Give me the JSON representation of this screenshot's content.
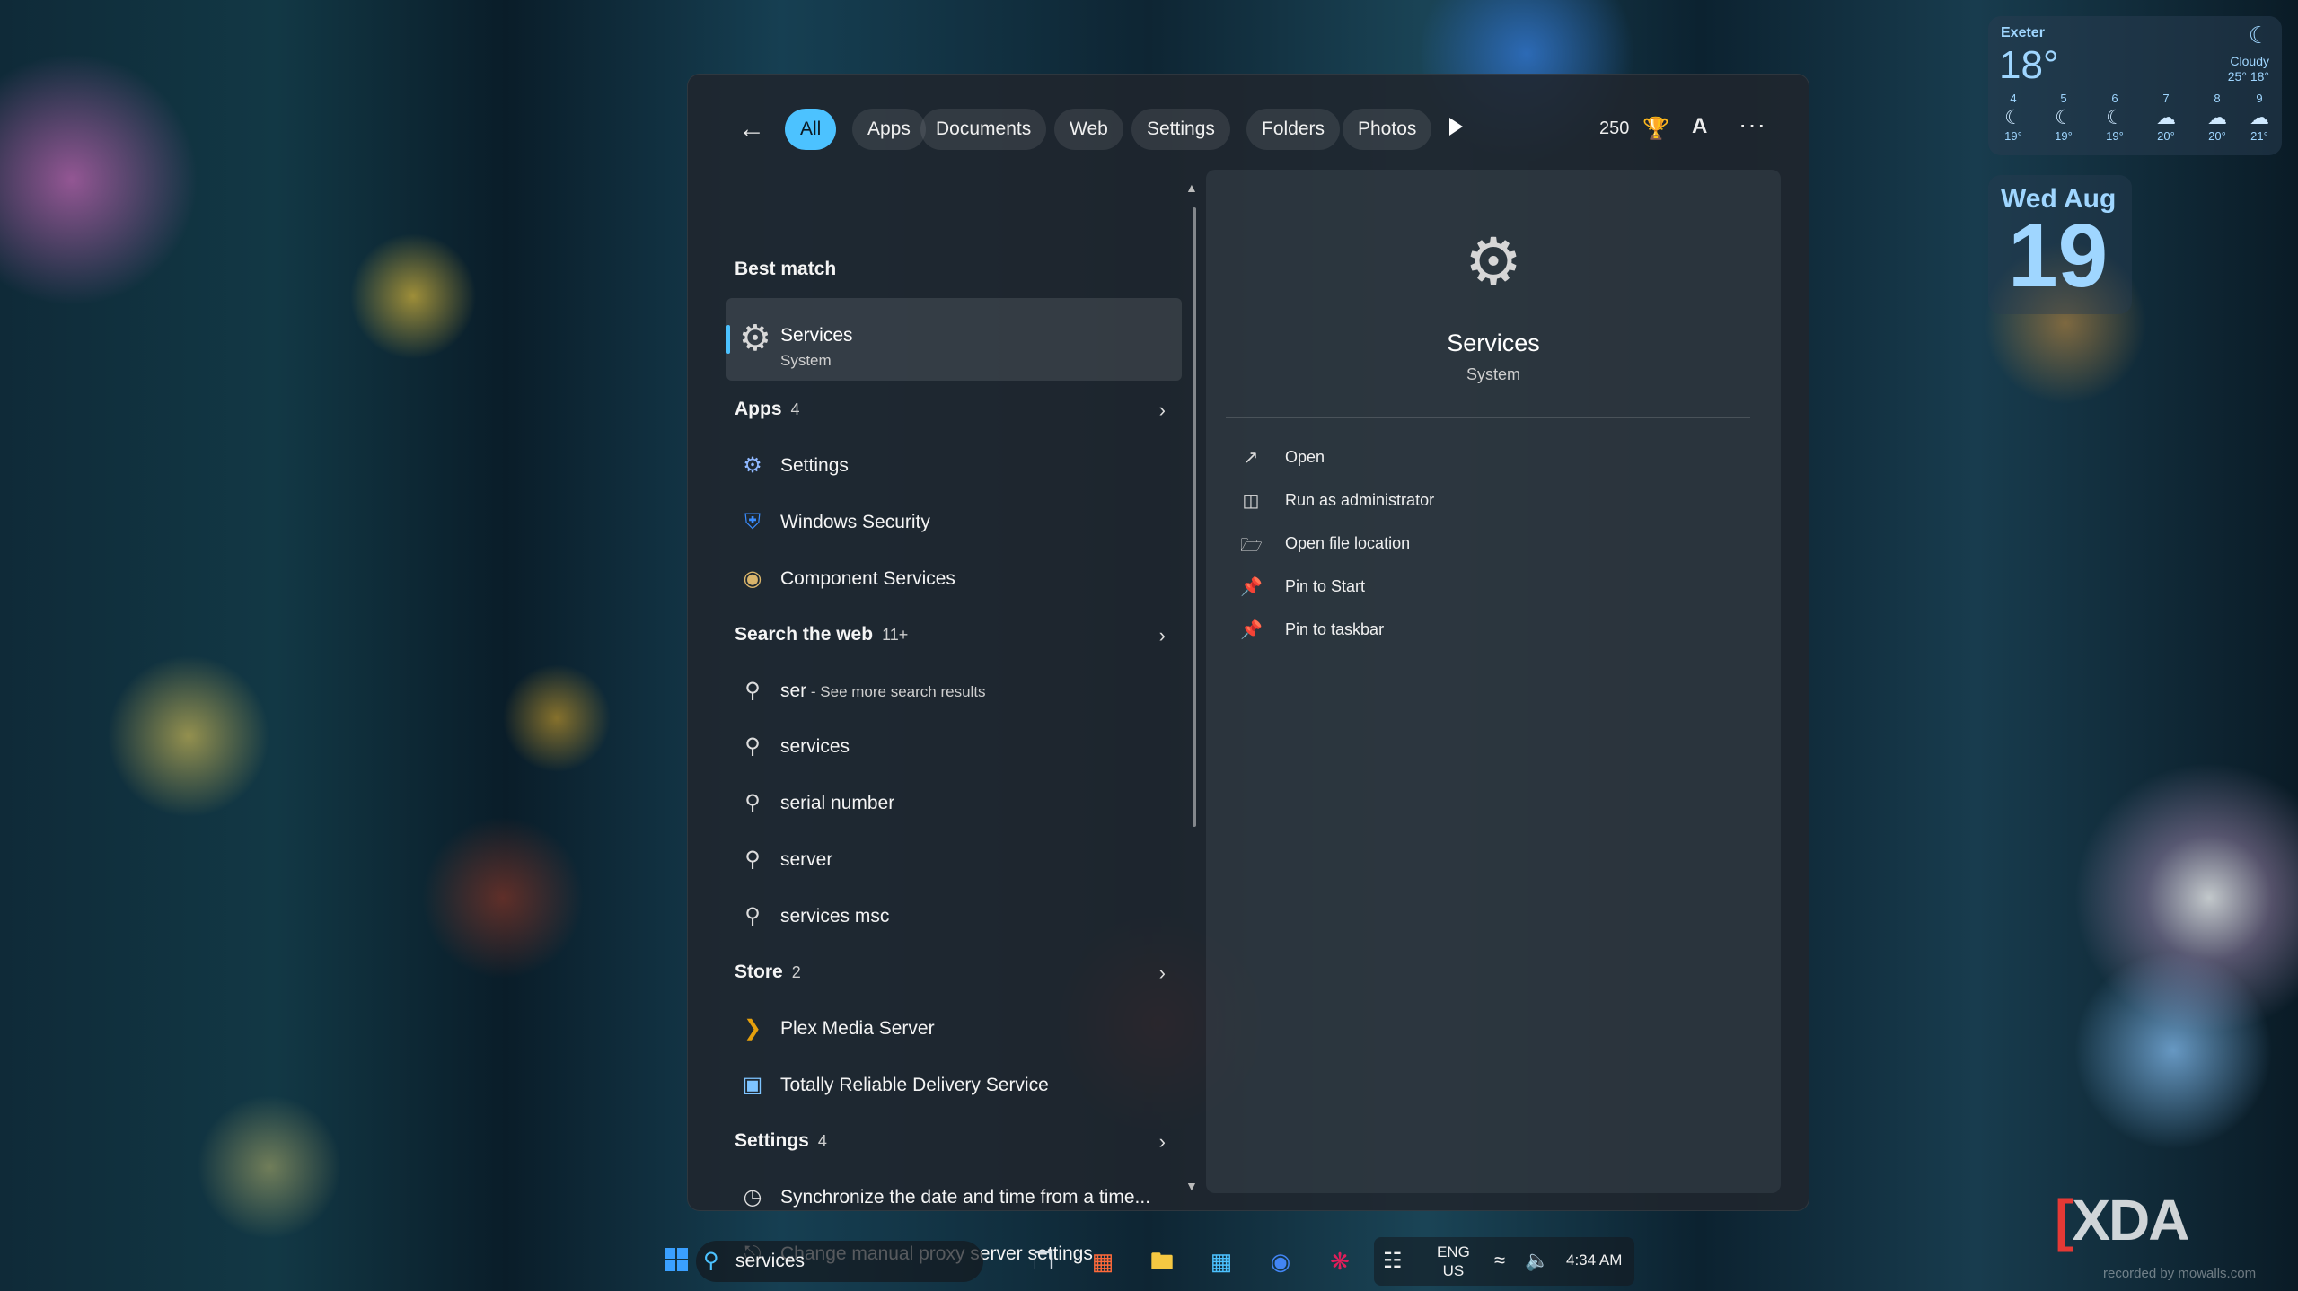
{
  "filters": {
    "tabs": [
      "All",
      "Apps",
      "Documents",
      "Web",
      "Settings",
      "Folders",
      "Photos"
    ],
    "active": "All",
    "points": "250",
    "avatar_letter": "A"
  },
  "results": {
    "best_match_header": "Best match",
    "best_match": {
      "title": "Services",
      "subtitle": "System"
    },
    "apps_header": "Apps",
    "apps_count": "4",
    "apps": [
      "Settings",
      "Windows Security",
      "Component Services"
    ],
    "web_header": "Search the web",
    "web_count": "11+",
    "web_first_query": "ser",
    "web_first_hint": " - See more search results",
    "web": [
      "services",
      "serial number",
      "server",
      "services msc"
    ],
    "store_header": "Store",
    "store_count": "2",
    "store": [
      "Plex Media Server",
      "Totally Reliable Delivery Service"
    ],
    "settings_header": "Settings",
    "settings_count": "4",
    "settings": [
      "Synchronize the date and time from a time...",
      "Change manual proxy server settings"
    ]
  },
  "detail": {
    "title": "Services",
    "subtitle": "System",
    "actions": [
      "Open",
      "Run as administrator",
      "Open file location",
      "Pin to Start",
      "Pin to taskbar"
    ]
  },
  "weather": {
    "city": "Exeter",
    "temp": "18°",
    "condition": "Cloudy",
    "hi_lo": "25° 18°",
    "forecast": [
      {
        "hour": "4",
        "icon": "moon-icon",
        "temp": "19°"
      },
      {
        "hour": "5",
        "icon": "moon-icon",
        "temp": "19°"
      },
      {
        "hour": "6",
        "icon": "moon-icon",
        "temp": "19°"
      },
      {
        "hour": "7",
        "icon": "cloud-icon",
        "temp": "20°"
      },
      {
        "hour": "8",
        "icon": "cloud-icon",
        "temp": "20°"
      },
      {
        "hour": "9",
        "icon": "cloud-icon",
        "temp": "21°"
      }
    ]
  },
  "date_widget": {
    "weekday_month": "Wed Aug",
    "day": "19"
  },
  "taskbar": {
    "search_value": "services",
    "lang": "ENG",
    "region": "US",
    "time": "4:34 AM"
  },
  "watermark": {
    "brand": "XDA",
    "recorded": "recorded by mowalls.com"
  },
  "colors": {
    "accent": "#4cc2ff",
    "start": "#3aa0ff"
  }
}
